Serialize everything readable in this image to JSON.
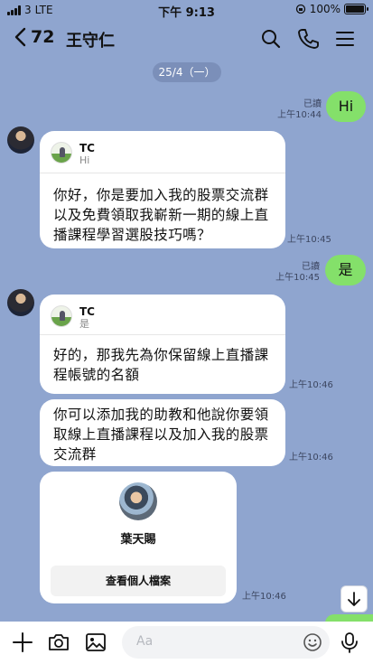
{
  "status_bar": {
    "carrier": "3",
    "network": "LTE",
    "time": "下午 9:13",
    "battery": "100%"
  },
  "header": {
    "unread_count": "72",
    "chat_name": "王守仁",
    "icons": [
      "search-icon",
      "phone-icon",
      "menu-icon"
    ]
  },
  "date_separator": "25/4（一）",
  "messages": {
    "m1": {
      "text": "Hi",
      "read": "已讀",
      "time": "上午10:44"
    },
    "m2": {
      "reply_name": "TC",
      "reply_text": "Hi",
      "lines": [
        "你好，你是要加入我的股票交流群",
        "以及免費領取我嶄新一期的線上直",
        "播課程學習選股技巧嗎？"
      ],
      "time": "上午10:45"
    },
    "m3": {
      "text": "是",
      "read": "已讀",
      "time": "上午10:45"
    },
    "m4": {
      "reply_name": "TC",
      "reply_text": "是",
      "lines": [
        "好的，那我先為你保留線上直播課",
        "程帳號的名額"
      ],
      "time": "上午10:46"
    },
    "m5": {
      "lines": [
        "你可以添加我的助教和他說你要領",
        "取線上直播課程以及加入我的股票",
        "交流群"
      ],
      "time": "上午10:46"
    },
    "m6": {
      "contact_name": "葉天賜",
      "button_label": "查看個人檔案",
      "time": "上午10:46"
    }
  },
  "input": {
    "placeholder": "Aa"
  },
  "colors": {
    "background": "#8fa5cf",
    "my_bubble": "#84e06a",
    "their_bubble": "#ffffff"
  }
}
